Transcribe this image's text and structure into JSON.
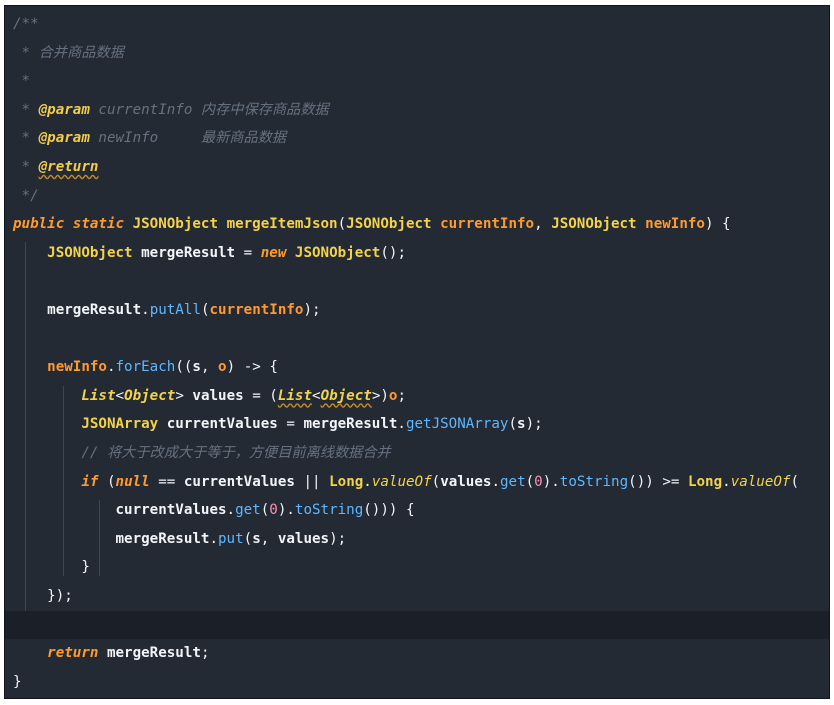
{
  "editor": {
    "theme_colors": {
      "background": "#232a34",
      "comment": "#66717f",
      "keyword": "#ff9a2f",
      "type": "#f3d24c",
      "method": "#5eb7ff",
      "number": "#ff8fb1",
      "text": "#f2f4f7"
    },
    "lines": [
      {
        "id": "l1",
        "text": "/**"
      },
      {
        "id": "l2",
        "text": " * 合并商品数据"
      },
      {
        "id": "l3",
        "text": " *"
      },
      {
        "id": "l4",
        "text": " * @param currentInfo 内存中保存商品数据"
      },
      {
        "id": "l5",
        "text": " * @param newInfo     最新商品数据"
      },
      {
        "id": "l6",
        "text": " * @return"
      },
      {
        "id": "l7",
        "text": " */"
      },
      {
        "id": "l8",
        "text": "public static JSONObject mergeItemJson(JSONObject currentInfo, JSONObject newInfo) {"
      },
      {
        "id": "l9",
        "text": "    JSONObject mergeResult = new JSONObject();"
      },
      {
        "id": "l10",
        "text": ""
      },
      {
        "id": "l11",
        "text": "    mergeResult.putAll(currentInfo);"
      },
      {
        "id": "l12",
        "text": ""
      },
      {
        "id": "l13",
        "text": "    newInfo.forEach((s, o) -> {"
      },
      {
        "id": "l14",
        "text": "        List<Object> values = (List<Object>)o;"
      },
      {
        "id": "l15",
        "text": "        JSONArray currentValues = mergeResult.getJSONArray(s);"
      },
      {
        "id": "l16",
        "text": "        // 将大于改成大于等于，方便目前离线数据合并"
      },
      {
        "id": "l17",
        "text": "        if (null == currentValues || Long.valueOf(values.get(0).toString()) >= Long.valueOf("
      },
      {
        "id": "l18",
        "text": "            currentValues.get(0).toString())) {"
      },
      {
        "id": "l19",
        "text": "            mergeResult.put(s, values);"
      },
      {
        "id": "l20",
        "text": "        }"
      },
      {
        "id": "l21",
        "text": "    });"
      },
      {
        "id": "l22",
        "text": ""
      },
      {
        "id": "l23",
        "text": "    return mergeResult;"
      },
      {
        "id": "l24",
        "text": "}"
      }
    ]
  }
}
